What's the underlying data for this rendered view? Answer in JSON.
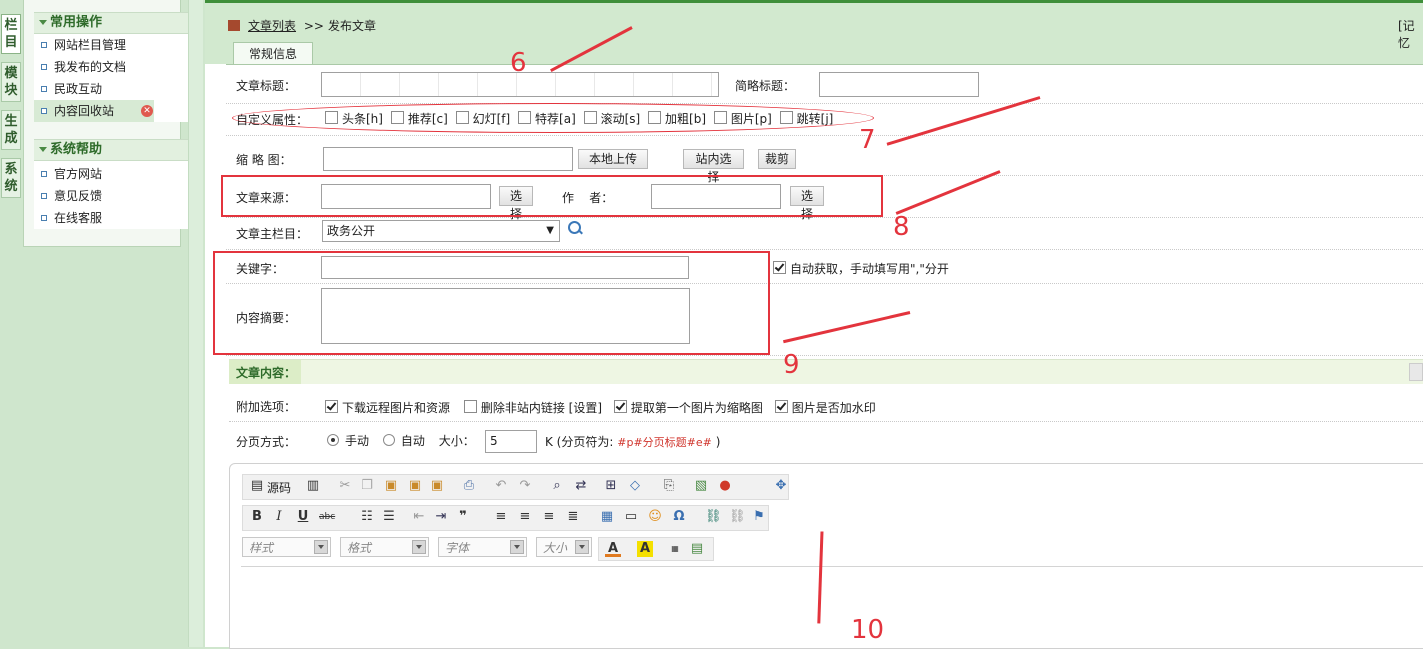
{
  "sidebar": {
    "vtabs": [
      "栏目",
      "模块",
      "生成",
      "系统"
    ],
    "sections": [
      {
        "title": "常用操作",
        "items": [
          "网站栏目管理",
          "我发布的文档",
          "民政互动",
          "内容回收站"
        ]
      },
      {
        "title": "系统帮助",
        "items": [
          "官方网站",
          "意见反馈",
          "在线客服"
        ]
      }
    ]
  },
  "header": {
    "crumb_link": "文章列表",
    "crumb_sep": ">>",
    "crumb_current": "发布文章",
    "record_link": "[记忆"
  },
  "tabs": {
    "general": "常规信息"
  },
  "form": {
    "title_label": "文章标题：",
    "short_title_label": "简略标题：",
    "attr_label": "自定义属性：",
    "attrs": [
      "头条[h]",
      "推荐[c]",
      "幻灯[f]",
      "特荐[a]",
      "滚动[s]",
      "加粗[b]",
      "图片[p]",
      "跳转[j]"
    ],
    "thumb_label": "缩 略 图：",
    "upload_btn": "本地上传",
    "site_select_btn": "站内选择",
    "crop_btn": "裁剪",
    "source_label": "文章来源：",
    "source_select_btn": "选择",
    "author_label": "作    者：",
    "author_select_btn": "选择",
    "column_label": "文章主栏目：",
    "column_value": "政务公开",
    "keywords_label": "关键字：",
    "auto_keywords_text": "自动获取，手动填写用\",\"分开",
    "summary_label": "内容摘要：",
    "content_head": "文章内容：",
    "extra_label": "附加选项：",
    "extra_options": [
      {
        "text": "下载远程图片和资源",
        "checked": true
      },
      {
        "text": "删除非站内链接 [设置]",
        "checked": false
      },
      {
        "text": "提取第一个图片为缩略图",
        "checked": true
      },
      {
        "text": "图片是否加水印",
        "checked": true
      }
    ],
    "paging_label": "分页方式：",
    "paging_manual": "手动",
    "paging_auto": "自动",
    "size_label": "大小：",
    "size_value": "5",
    "paging_hint_prefix": "K (分页符为:",
    "paging_token": "#p#分页标题#e#",
    "paging_hint_suffix": ")"
  },
  "editor": {
    "source_btn": "源码",
    "style_placeholder": "样式",
    "format_placeholder": "格式",
    "font_placeholder": "字体",
    "size_placeholder": "大小"
  },
  "annotations": [
    "6",
    "7",
    "8",
    "9",
    "10"
  ],
  "colors": {
    "annotation": "#e3343d",
    "accent": "#3f8f3a"
  }
}
